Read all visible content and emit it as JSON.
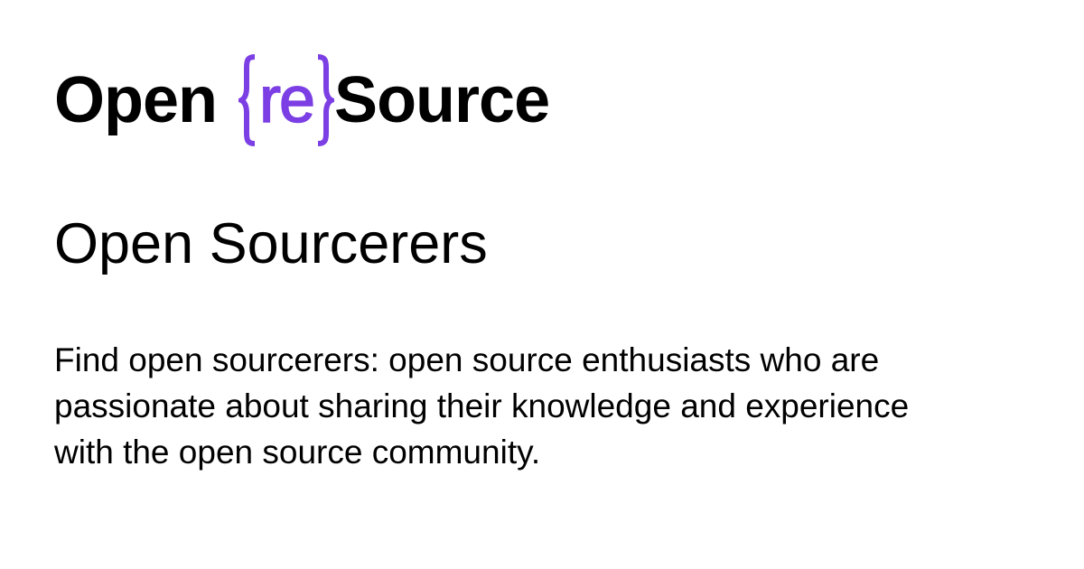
{
  "brand": {
    "word_before": "Open",
    "accent_text": "re",
    "word_after": "Source",
    "accent_color": "#7b3fe4",
    "text_color": "#000000",
    "brace_left_icon": "left-curly-brace",
    "brace_right_icon": "right-curly-brace"
  },
  "page": {
    "title": "Open Sourcerers",
    "description": "Find open sourcerers: open source enthusiasts who are passionate about sharing their knowledge and experience with the open source community.",
    "background_color": "#ffffff"
  }
}
